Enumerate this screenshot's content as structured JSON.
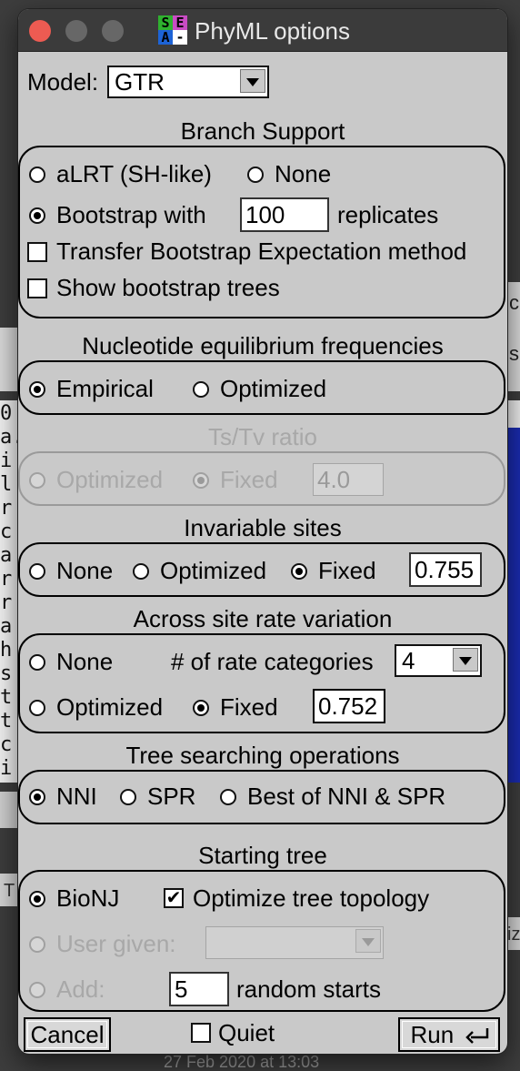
{
  "window": {
    "title": "PhyML options"
  },
  "model": {
    "label": "Model:",
    "value": "GTR"
  },
  "branch_support": {
    "title": "Branch Support",
    "alrt_label": "aLRT (SH-like)",
    "none_label": "None",
    "bootstrap_label": "Bootstrap with",
    "bootstrap_value": "100",
    "replicates_label": "replicates",
    "tbe_label": "Transfer Bootstrap Expectation method",
    "show_trees_label": "Show bootstrap trees"
  },
  "nucleotide": {
    "title": "Nucleotide equilibrium frequencies",
    "empirical_label": "Empirical",
    "optimized_label": "Optimized"
  },
  "tstv": {
    "title": "Ts/Tv ratio",
    "optimized_label": "Optimized",
    "fixed_label": "Fixed",
    "value": "4.0"
  },
  "invariable": {
    "title": "Invariable sites",
    "none_label": "None",
    "optimized_label": "Optimized",
    "fixed_label": "Fixed",
    "value": "0.755"
  },
  "rate_variation": {
    "title": "Across site rate variation",
    "none_label": "None",
    "categories_label": "# of rate categories",
    "categories_value": "4",
    "optimized_label": "Optimized",
    "fixed_label": "Fixed",
    "value": "0.752"
  },
  "tree_search": {
    "title": "Tree searching operations",
    "nni_label": "NNI",
    "spr_label": "SPR",
    "best_label": "Best of NNI & SPR"
  },
  "starting_tree": {
    "title": "Starting tree",
    "bionj_label": "BioNJ",
    "optimize_topology_label": "Optimize tree topology",
    "user_given_label": "User given:",
    "user_given_value": "",
    "add_label": "Add:",
    "random_value": "5",
    "random_label": "random starts"
  },
  "footer": {
    "cancel_label": "Cancel",
    "quiet_label": "Quiet",
    "run_label": "Run"
  },
  "background": {
    "mono_column": [
      "0",
      "a.",
      "i",
      "l",
      "r",
      "c",
      "a",
      "r",
      "r",
      "a",
      "h",
      "s",
      "t",
      "t",
      "c",
      "i"
    ],
    "fragment_right_top": "c",
    "fragment_right_mid": "s",
    "fragment_bottom_left": "T",
    "fragment_bottom_right": "iz",
    "bottom_text": "27 Feb 2020 at 13:03"
  },
  "colors": {
    "window_bg": "#c9c9c9",
    "titlebar_bg": "#3b3b3b",
    "close_button": "#ed5b52",
    "icon_s": "#2fb12f",
    "icon_e": "#c94cc4",
    "icon_a": "#1d63d6"
  }
}
